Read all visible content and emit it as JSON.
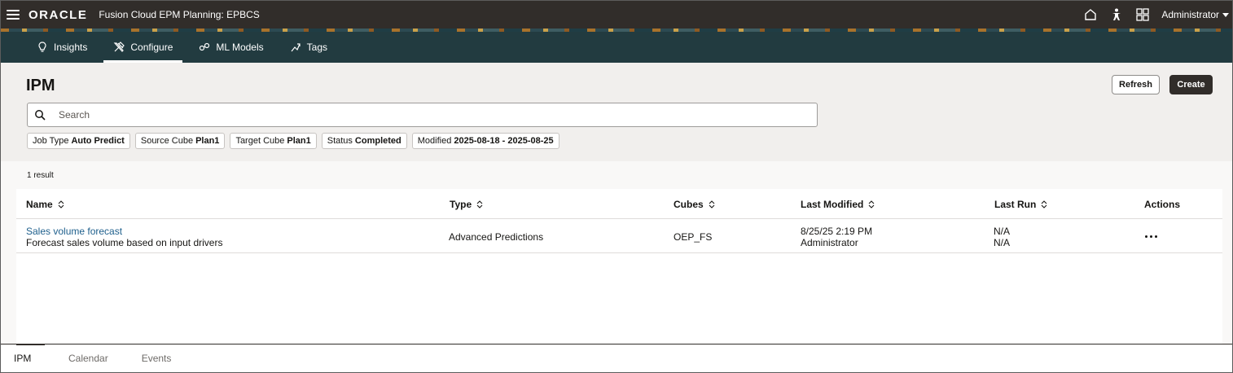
{
  "topbar": {
    "logo": "ORACLE",
    "app_title": "Fusion Cloud EPM Planning: EPBCS",
    "user": "Administrator",
    "icons": [
      "home-icon",
      "accessibility-icon",
      "navigator-grid-icon"
    ]
  },
  "nav": {
    "tabs": [
      {
        "label": "Insights",
        "icon": "insights-icon",
        "active": false
      },
      {
        "label": "Configure",
        "icon": "configure-icon",
        "active": true
      },
      {
        "label": "ML Models",
        "icon": "ml-models-icon",
        "active": false
      },
      {
        "label": "Tags",
        "icon": "tags-icon",
        "active": false
      }
    ]
  },
  "page": {
    "title": "IPM",
    "refresh_label": "Refresh",
    "create_label": "Create"
  },
  "search": {
    "placeholder": "Search",
    "value": ""
  },
  "filters": [
    {
      "name": "Job Type",
      "value": "Auto Predict"
    },
    {
      "name": "Source Cube",
      "value": "Plan1"
    },
    {
      "name": "Target Cube",
      "value": "Plan1"
    },
    {
      "name": "Status",
      "value": "Completed"
    },
    {
      "name": "Modified",
      "value": "2025-08-18 - 2025-08-25"
    }
  ],
  "results": {
    "count_label": "1 result",
    "columns": [
      "Name",
      "Type",
      "Cubes",
      "Last Modified",
      "Last Run",
      "Actions"
    ],
    "rows": [
      {
        "name": "Sales volume forecast",
        "description": "Forecast sales volume based on input drivers",
        "type": "Advanced Predictions",
        "cubes": "OEP_FS",
        "last_modified_date": "8/25/25 2:19 PM",
        "last_modified_by": "Administrator",
        "last_run_1": "N/A",
        "last_run_2": "N/A"
      }
    ]
  },
  "bottom_tabs": [
    {
      "label": "IPM",
      "active": true
    },
    {
      "label": "Calendar",
      "active": false
    },
    {
      "label": "Events",
      "active": false
    }
  ]
}
